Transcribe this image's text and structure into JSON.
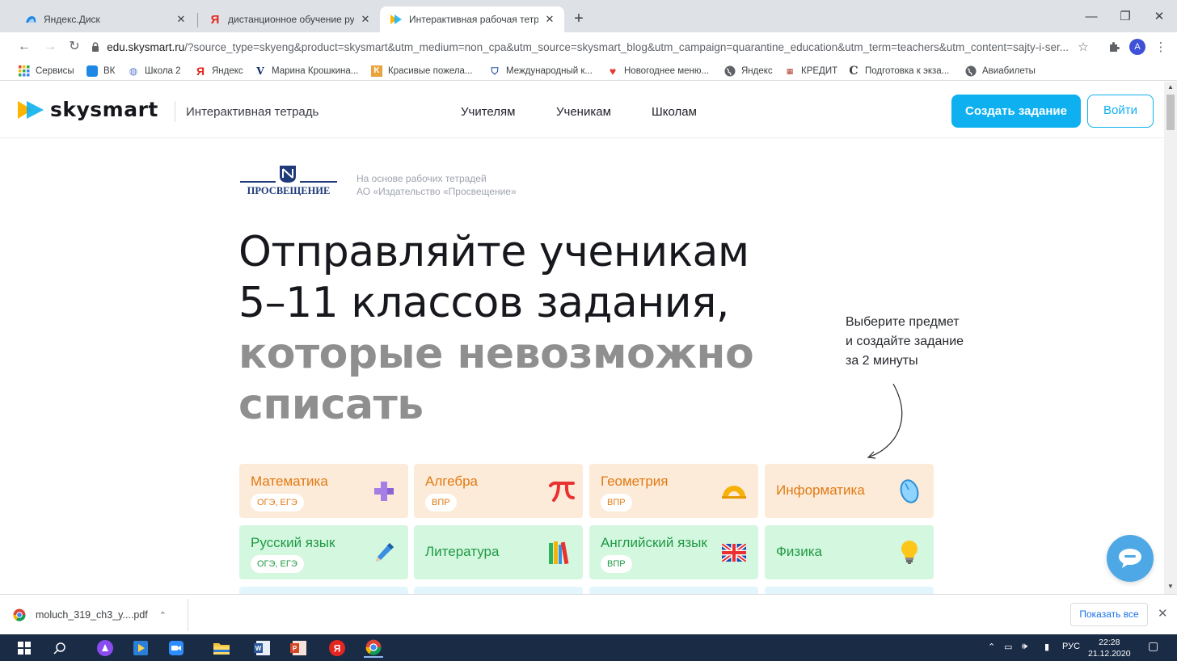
{
  "browser": {
    "tabs": [
      {
        "title": "Яндекс.Диск",
        "icon": "yandex-disk-icon"
      },
      {
        "title": "дистанционное обучение русск",
        "icon": "yandex-icon"
      },
      {
        "title": "Интерактивная рабочая тетрадь",
        "icon": "skysmart-icon",
        "active": true
      }
    ],
    "new_tab": "+",
    "window_controls": {
      "minimize": "—",
      "maximize": "❐",
      "close": "✕"
    },
    "url_host": "edu.skysmart.ru",
    "url_path": "/?source_type=skyeng&product=skysmart&utm_medium=non_cpa&utm_source=skysmart_blog&utm_campaign=quarantine_education&utm_term=teachers&utm_content=sajty-i-ser...",
    "profile_initial": "A",
    "bookmarks": [
      {
        "label": "Сервисы",
        "icon": "apps-grid-icon"
      },
      {
        "label": "ВК",
        "icon": "vk-icon"
      },
      {
        "label": "Школа 2",
        "icon": "school-icon"
      },
      {
        "label": "Яндекс",
        "icon": "yandex-icon"
      },
      {
        "label": "Марина Крошкина...",
        "icon": "v-icon"
      },
      {
        "label": "Красивые пожела...",
        "icon": "k-icon"
      },
      {
        "label": "Международный к...",
        "icon": "shield-icon"
      },
      {
        "label": "Новогоднее меню...",
        "icon": "heart-icon"
      },
      {
        "label": "Яндекс",
        "icon": "globe-icon"
      },
      {
        "label": "КРЕДИТ",
        "icon": "bank-icon"
      },
      {
        "label": "Подготовка к экза...",
        "icon": "c-icon"
      },
      {
        "label": "Авиабилеты",
        "icon": "globe-icon"
      }
    ]
  },
  "site": {
    "logo": "skysmart",
    "logo_sub": "Интерактивная тетрадь",
    "nav": [
      "Учителям",
      "Ученикам",
      "Школам"
    ],
    "create_button": "Создать задание",
    "login_button": "Войти",
    "publisher": "ПРОСВЕЩЕНИЕ",
    "publisher_note_1": "На основе рабочих тетрадей",
    "publisher_note_2": "АО «Издательство «Просвещение»",
    "hero_line1": "Отправляйте ученикам",
    "hero_line2": "5–11 классов задания,",
    "hero_line3": "которые невозможно",
    "hero_line4": "списать",
    "hint_line1": "Выберите предмет",
    "hint_line2": "и создайте задание",
    "hint_line3": "за 2 минуты",
    "subjects": [
      {
        "name": "Математика",
        "tag": "ОГЭ, ЕГЭ",
        "icon": "plus-icon",
        "color": "peach"
      },
      {
        "name": "Алгебра",
        "tag": "ВПР",
        "icon": "pi-icon",
        "color": "peach"
      },
      {
        "name": "Геометрия",
        "tag": "ВПР",
        "icon": "protractor-icon",
        "color": "peach"
      },
      {
        "name": "Информатика",
        "tag": "",
        "icon": "mouse-icon",
        "color": "peach"
      },
      {
        "name": "Русский язык",
        "tag": "ОГЭ, ЕГЭ",
        "icon": "pen-icon",
        "color": "mint"
      },
      {
        "name": "Литература",
        "tag": "",
        "icon": "books-icon",
        "color": "mint"
      },
      {
        "name": "Английский язык",
        "tag": "ВПР",
        "icon": "uk-flag-icon",
        "color": "mint"
      },
      {
        "name": "Физика",
        "tag": "",
        "icon": "lightbulb-icon",
        "color": "mint"
      }
    ]
  },
  "downloads": {
    "file": "moluch_319_ch3_y....pdf",
    "show_all": "Показать все"
  },
  "taskbar": {
    "lang": "РУС",
    "time": "22:28",
    "date": "21.12.2020"
  },
  "colors": {
    "accent": "#0eb0f0",
    "peach_bg": "#fdebd9",
    "peach_text": "#e07a13",
    "mint_bg": "#d4f7df",
    "mint_text": "#1f9a44"
  }
}
